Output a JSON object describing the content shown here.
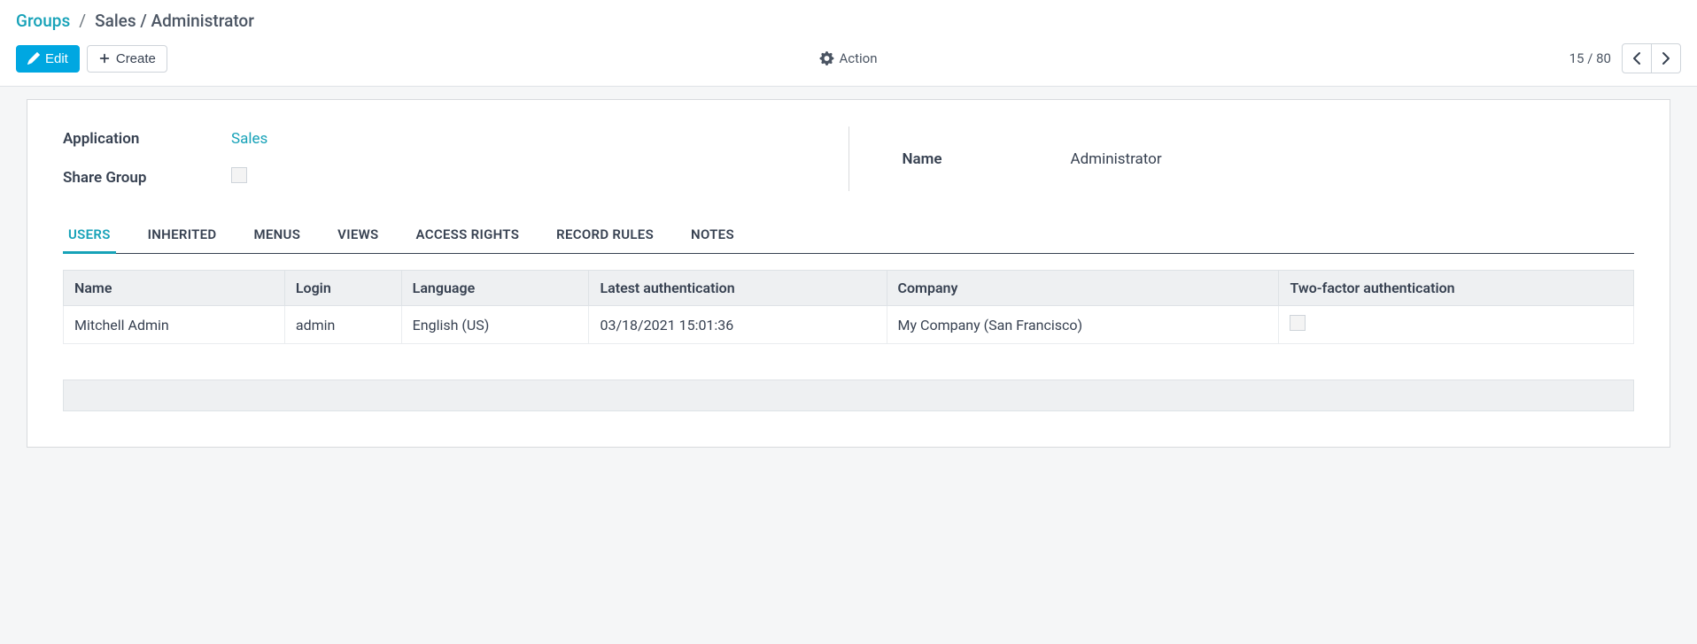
{
  "breadcrumb": {
    "root": "Groups",
    "sep": "/",
    "current": "Sales / Administrator"
  },
  "toolbar": {
    "edit_label": "Edit",
    "create_label": "Create",
    "action_label": "Action",
    "pager": {
      "current": "15",
      "sep": "/",
      "total": "80"
    }
  },
  "form": {
    "left": {
      "application_label": "Application",
      "application_value": "Sales",
      "share_label": "Share Group"
    },
    "right": {
      "name_label": "Name",
      "name_value": "Administrator"
    }
  },
  "tabs": [
    {
      "label": "USERS",
      "active": true
    },
    {
      "label": "INHERITED",
      "active": false
    },
    {
      "label": "MENUS",
      "active": false
    },
    {
      "label": "VIEWS",
      "active": false
    },
    {
      "label": "ACCESS RIGHTS",
      "active": false
    },
    {
      "label": "RECORD RULES",
      "active": false
    },
    {
      "label": "NOTES",
      "active": false
    }
  ],
  "table": {
    "headers": {
      "name": "Name",
      "login": "Login",
      "language": "Language",
      "latest_auth": "Latest authentication",
      "company": "Company",
      "two_factor": "Two-factor authentication"
    },
    "rows": [
      {
        "name": "Mitchell Admin",
        "login": "admin",
        "language": "English (US)",
        "latest_auth": "03/18/2021 15:01:36",
        "company": "My Company (San Francisco)",
        "two_factor": false
      }
    ]
  }
}
